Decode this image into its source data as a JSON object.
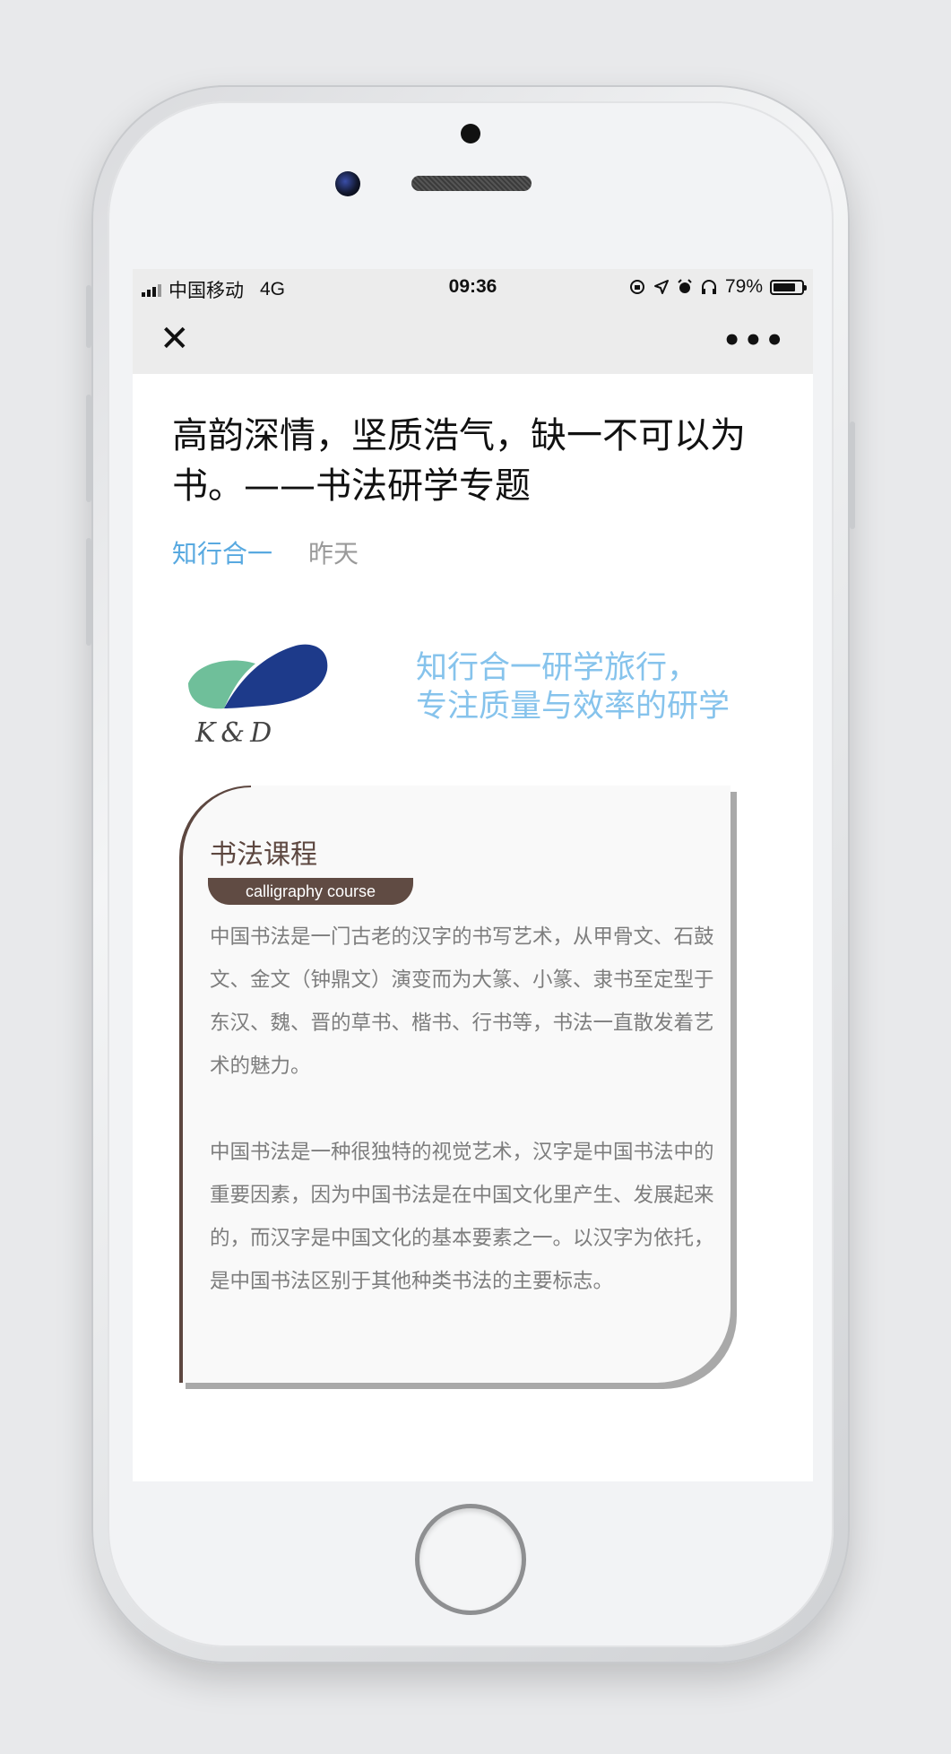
{
  "status_bar": {
    "carrier": "中国移动",
    "network": "4G",
    "time": "09:36",
    "battery_percent": "79%",
    "battery_level": 0.79,
    "icons": [
      "signal-icon",
      "orientation-lock-icon",
      "location-icon",
      "alarm-icon",
      "headphones-icon",
      "battery-icon"
    ]
  },
  "nav": {
    "close_icon": "close-icon",
    "more_icon": "more-icon",
    "close_glyph": "✕",
    "more_glyph": "•••"
  },
  "article": {
    "title": "高韵深情，坚质浩气，缺一不可以为书。——书法研学专题",
    "author": "知行合一",
    "date": "昨天"
  },
  "banner": {
    "logo_text": "K&D",
    "slogan_line1": "知行合一研学旅行，",
    "slogan_line2": "专注质量与效率的研学"
  },
  "card": {
    "title": "书法课程",
    "tag": "calligraphy course",
    "paragraph1": "中国书法是一门古老的汉字的书写艺术，从甲骨文、石鼓文、金文（钟鼎文）演变而为大篆、小篆、隶书至定型于东汉、魏、晋的草书、楷书、行书等，书法一直散发着艺术的魅力。",
    "paragraph2": "中国书法是一种很独特的视觉艺术，汉字是中国书法中的重要因素，因为中国书法是在中国文化里产生、发展起来的，而汉字是中国文化的基本要素之一。以汉字为依托，是中国书法区别于其他种类书法的主要标志。"
  },
  "colors": {
    "link_blue": "#58a9e0",
    "slogan_blue": "#86c3ec",
    "card_brown": "#5d4740",
    "body_gray": "#7d7d7d"
  }
}
